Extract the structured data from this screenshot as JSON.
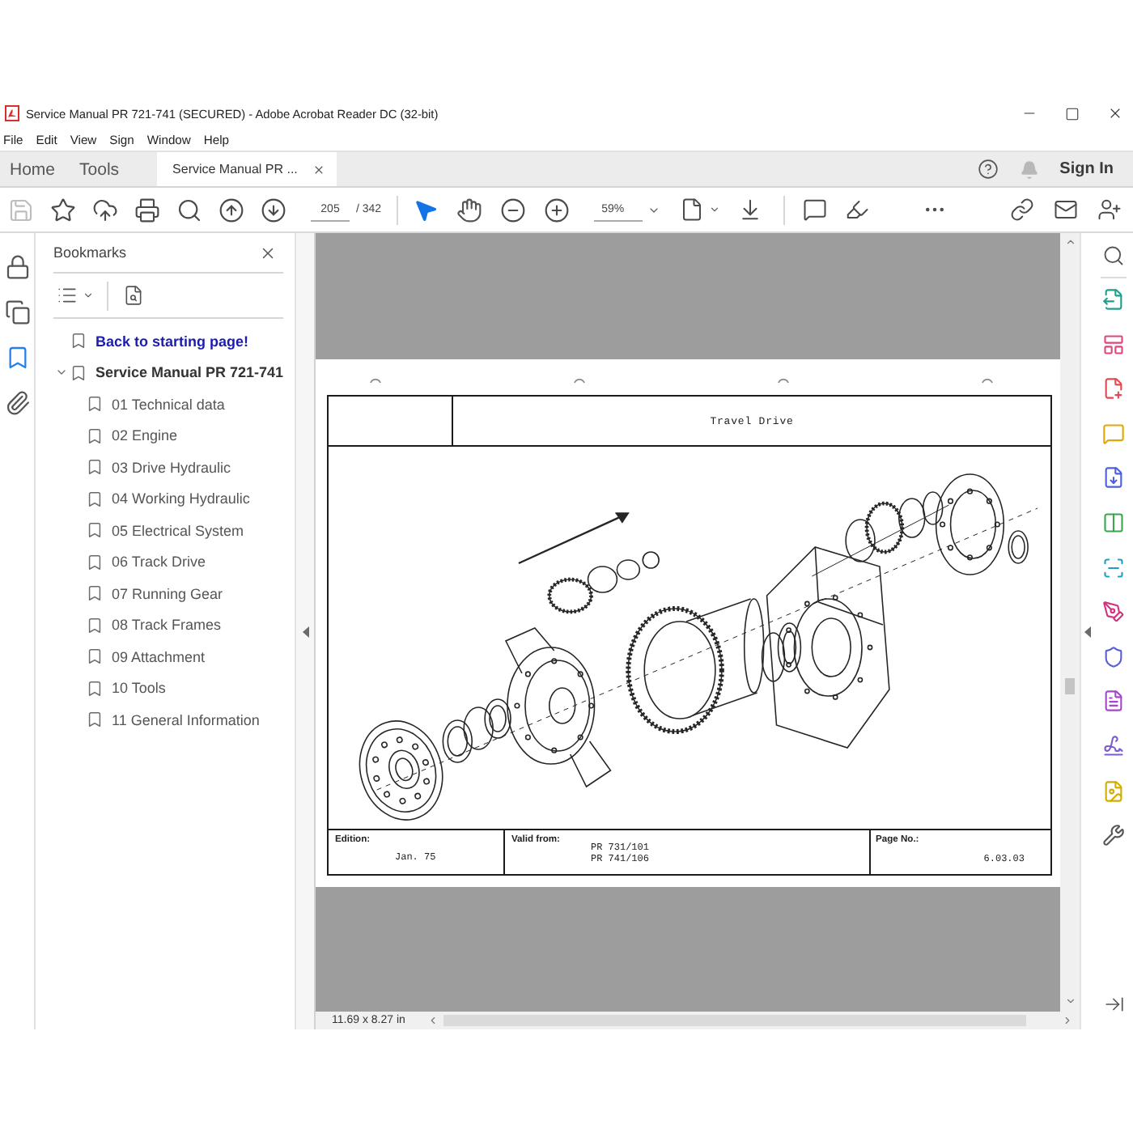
{
  "window": {
    "title": "Service Manual PR 721-741 (SECURED) - Adobe Acrobat Reader DC (32-bit)"
  },
  "menu": [
    "File",
    "Edit",
    "View",
    "Sign",
    "Window",
    "Help"
  ],
  "tabs": [
    {
      "label": "Home",
      "kind": "app",
      "selected": false
    },
    {
      "label": "Tools",
      "kind": "app",
      "selected": false
    },
    {
      "label": "Service Manual PR ...",
      "kind": "document",
      "selected": true
    }
  ],
  "account": {
    "label": "Sign In"
  },
  "toolbar": {
    "save": {
      "disabled": true
    },
    "page": "205",
    "page_count": "/ 342",
    "pointer": {
      "selected": true
    },
    "hand": {
      "selected": false
    },
    "zoom": "59%"
  },
  "nav_panel": [
    {
      "selected": false
    },
    {
      "selected": false
    },
    {
      "selected": true
    },
    {
      "selected": false
    }
  ],
  "bookmarks": {
    "title": "Bookmarks",
    "items": [
      {
        "label": "Back to starting page!",
        "kind": "link"
      },
      {
        "label": "Service Manual PR 721-741",
        "kind": "section",
        "expanded": true,
        "children": [
          {
            "label": "01 Technical data"
          },
          {
            "label": "02 Engine"
          },
          {
            "label": "03 Drive Hydraulic"
          },
          {
            "label": "04 Working Hydraulic"
          },
          {
            "label": "05 Electrical System"
          },
          {
            "label": "06 Track Drive"
          },
          {
            "label": "07 Running Gear"
          },
          {
            "label": "08 Track Frames"
          },
          {
            "label": "09 Attachment"
          },
          {
            "label": "10 Tools"
          },
          {
            "label": "11 General Information"
          }
        ]
      }
    ]
  },
  "document_page": {
    "title": "Travel Drive",
    "edition_label": "Edition:",
    "edition": "Jan. 75",
    "valid_from_label": "Valid from:",
    "valid_from": [
      "PR 731/101",
      "PR 741/106"
    ],
    "page_no_label": "Page No.:",
    "page_no": "6.03.03"
  },
  "status_bar": {
    "page_size": "11.69 x 8.27 in"
  }
}
